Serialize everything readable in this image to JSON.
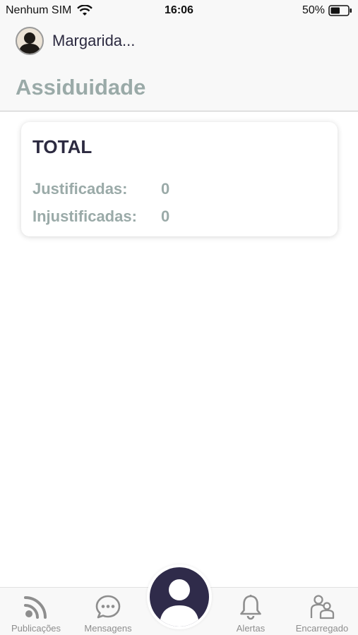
{
  "status_bar": {
    "carrier": "Nenhum SIM",
    "time": "16:06",
    "battery": "50%"
  },
  "header": {
    "user_name": "Margarida...",
    "title": "Assiduidade"
  },
  "card": {
    "title": "TOTAL",
    "rows": [
      {
        "label": "Justificadas:",
        "value": "0"
      },
      {
        "label": "Injustificadas:",
        "value": "0"
      }
    ]
  },
  "tab_bar": {
    "items": [
      {
        "label": "Publicações",
        "icon": "rss-icon"
      },
      {
        "label": "Mensagens",
        "icon": "chat-bubble-icon"
      },
      {
        "label": "",
        "icon": "profile-icon"
      },
      {
        "label": "Alertas",
        "icon": "bell-icon"
      },
      {
        "label": "Encarregado",
        "icon": "guardian-icon"
      }
    ]
  },
  "colors": {
    "primary_dark": "#2f2b4a",
    "muted_teal": "#9aaaa8",
    "tab_gray": "#8e8e8e"
  }
}
